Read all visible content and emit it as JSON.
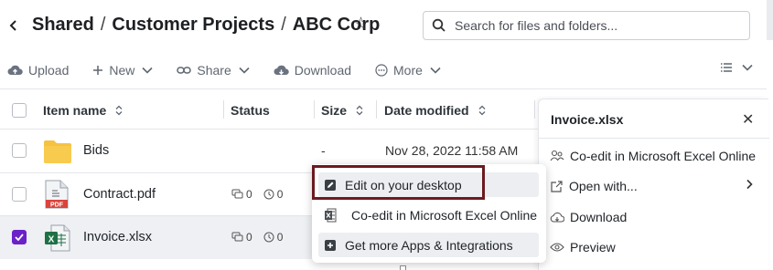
{
  "header": {
    "breadcrumbs": [
      "Shared",
      "Customer Projects",
      "ABC Corp"
    ],
    "separator": "/",
    "search_placeholder": "Search for files and folders..."
  },
  "toolbar": {
    "upload": "Upload",
    "new": "New",
    "share": "Share",
    "download": "Download",
    "more": "More"
  },
  "table": {
    "columns": {
      "name": "Item name",
      "status": "Status",
      "size": "Size",
      "date": "Date modified"
    },
    "rows": [
      {
        "name": "Bids",
        "type": "folder",
        "size": "-",
        "date": "Nov 28, 2022 11:58 AM",
        "comments": "",
        "versions": "",
        "selected": false
      },
      {
        "name": "Contract.pdf",
        "type": "pdf",
        "size": "",
        "date": "",
        "comments": "0",
        "versions": "0",
        "selected": false
      },
      {
        "name": "Invoice.xlsx",
        "type": "xlsx",
        "size": "",
        "date": "",
        "comments": "0",
        "versions": "0",
        "selected": true
      }
    ]
  },
  "right_panel": {
    "title": "Invoice.xlsx",
    "items": [
      "Co-edit in Microsoft Excel Online",
      "Open with...",
      "Download",
      "Preview"
    ]
  },
  "context_menu": {
    "items": [
      "Edit on your desktop",
      "Co-edit in Microsoft Excel Online",
      "Get more Apps & Integrations"
    ]
  },
  "colors": {
    "accent_purple": "#6b21c8",
    "focus_outline": "#6b1a20",
    "folder_yellow": "#f5c242",
    "pdf_red": "#d9443c",
    "excel_green": "#1e7145"
  }
}
